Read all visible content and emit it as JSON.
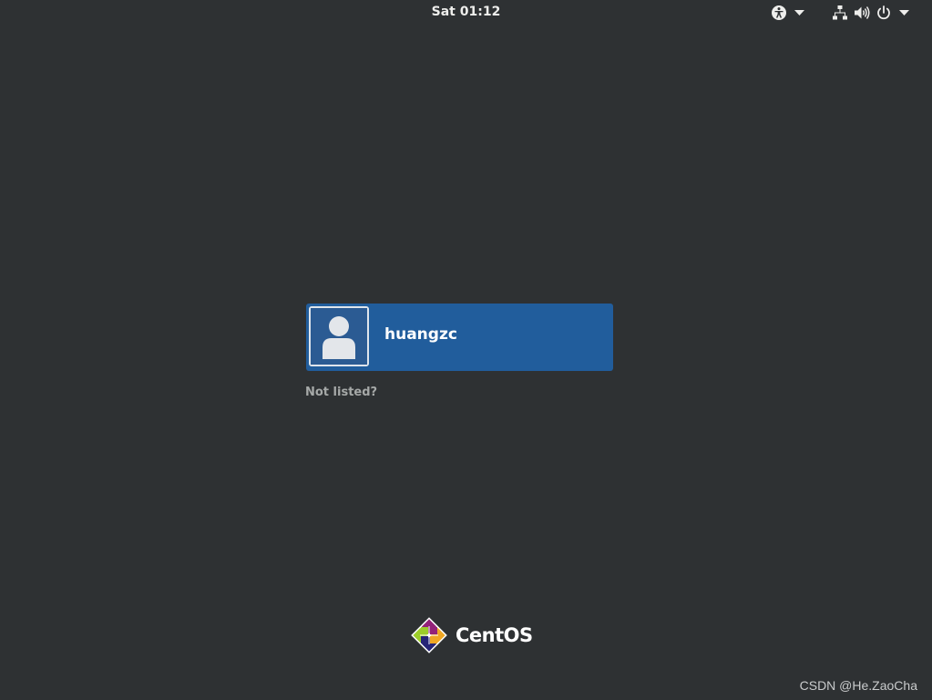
{
  "top_bar": {
    "clock": "Sat 01:12",
    "icons": {
      "accessibility": "accessibility-icon",
      "network": "network-icon",
      "volume": "volume-icon",
      "power": "power-icon",
      "menu_arrow": "chevron-down-icon"
    }
  },
  "login": {
    "users": [
      {
        "name": "huangzc",
        "avatar": "default-user-avatar-icon"
      }
    ],
    "not_listed_label": "Not listed?"
  },
  "branding": {
    "logo_text": "CentOS",
    "logo_icon": "centos-logo-icon"
  },
  "watermark": "CSDN @He.ZaoCha",
  "colors": {
    "background": "#2e3133",
    "user_button": "#215d9c",
    "not_listed_text": "#a6a9a8"
  }
}
